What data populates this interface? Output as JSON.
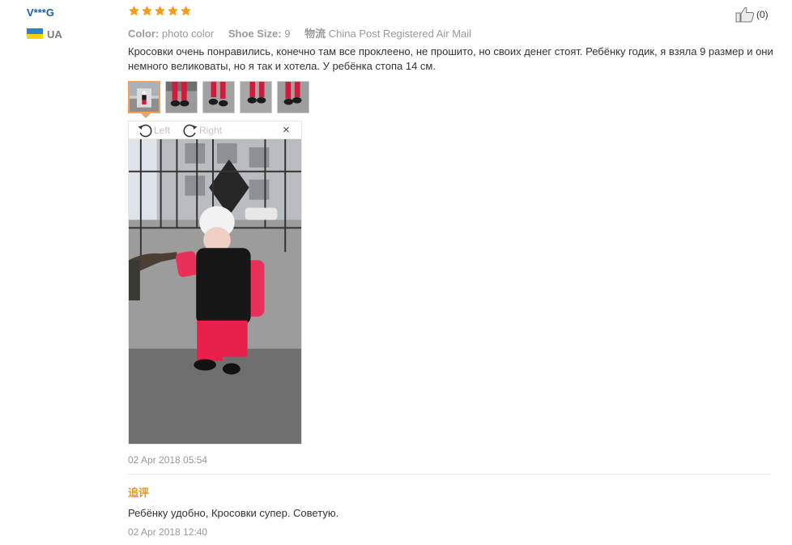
{
  "user": {
    "name": "V***G",
    "country": "UA",
    "flag_colors": [
      "#2f7fd3",
      "#f5d400"
    ]
  },
  "review": {
    "rating": 5,
    "star_color": "#f0a020",
    "color_label": "Color:",
    "color_value": "photo color",
    "size_label": "Shoe Size:",
    "size_value": "9",
    "shipping_label": "物流",
    "shipping_value": "China Post Registered Air Mail",
    "like_count": "(0)",
    "text": "Кросовки очень понравились, конечно там все проклеено, не прошито, но своих денег стоят. Ребёнку годик, я взяла 9 размер и они немного великоваты, но я так и хотела. У ребёнка стопа 14 см.",
    "thumbnail_count": 5,
    "active_thumbnail": 1,
    "rotate_left_label": "Left",
    "rotate_right_label": "Right",
    "close_label": "×",
    "date": "02 Apr 2018 05:54"
  },
  "followup": {
    "title": "追评",
    "text": "Ребёнку удобно, Кросовки супер. Советую.",
    "date": "02 Apr 2018 12:40"
  },
  "icons": {
    "star": "star-icon",
    "like": "thumbs-up-icon",
    "rotate_left": "rotate-left-icon",
    "rotate_right": "rotate-right-icon",
    "close": "close-icon"
  }
}
